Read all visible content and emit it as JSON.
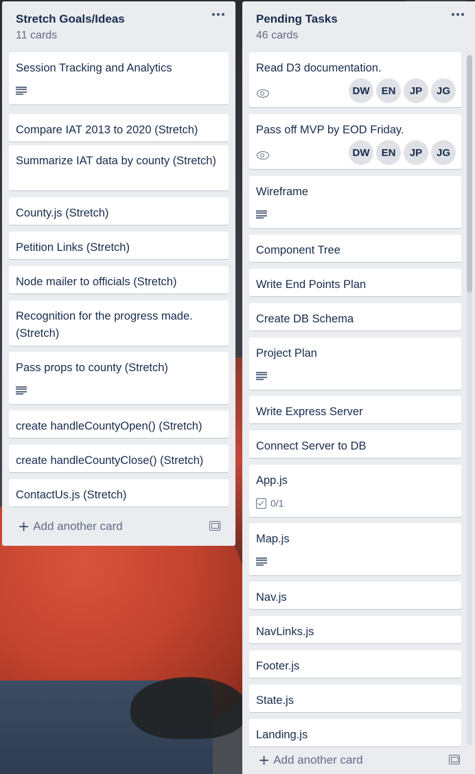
{
  "lists": [
    {
      "title": "Stretch Goals/Ideas",
      "count": "11 cards",
      "add_label": "Add another card",
      "cards": [
        {
          "title": "Session Tracking and Analytics",
          "badge": "description"
        },
        {
          "title": "Compare IAT 2013 to 2020 (Stretch)"
        },
        {
          "title": "Summarize IAT data by county (Stretch)"
        },
        {
          "title": "County.js (Stretch)"
        },
        {
          "title": "Petition Links (Stretch)"
        },
        {
          "title": "Node mailer to officials (Stretch)"
        },
        {
          "title": "Recognition for the progress made. (Stretch)"
        },
        {
          "title": "Pass props to county (Stretch)",
          "badge": "description"
        },
        {
          "title": "create handleCountyOpen() (Stretch)"
        },
        {
          "title": "create handleCountyClose() (Stretch)"
        },
        {
          "title": "ContactUs.js (Stretch)"
        }
      ]
    },
    {
      "title": "Pending Tasks",
      "count": "46 cards",
      "add_label": "Add another card",
      "cards": [
        {
          "title": "Read D3 documentation.",
          "badge": "watching",
          "members": [
            "DW",
            "EN",
            "JP",
            "JG"
          ]
        },
        {
          "title": "Pass off MVP by EOD Friday.",
          "badge": "watching",
          "members": [
            "DW",
            "EN",
            "JP",
            "JG"
          ]
        },
        {
          "title": "Wireframe",
          "badge": "description"
        },
        {
          "title": "Component Tree"
        },
        {
          "title": "Write End Points Plan"
        },
        {
          "title": "Create DB Schema"
        },
        {
          "title": "Project Plan",
          "badge": "description"
        },
        {
          "title": "Write Express Server"
        },
        {
          "title": "Connect Server to DB"
        },
        {
          "title": "App.js",
          "badge": "checklist",
          "checklist": "0/1"
        },
        {
          "title": "Map.js",
          "badge": "description"
        },
        {
          "title": "Nav.js"
        },
        {
          "title": "NavLinks.js"
        },
        {
          "title": "Footer.js"
        },
        {
          "title": "State.js"
        },
        {
          "title": "Landing.js"
        }
      ]
    }
  ],
  "icons": {
    "list_menu": "more-horizontal-icon",
    "description": "description-lines-icon",
    "watching": "eye-icon",
    "checklist": "checklist-icon",
    "add": "plus-icon",
    "template": "card-template-icon"
  }
}
